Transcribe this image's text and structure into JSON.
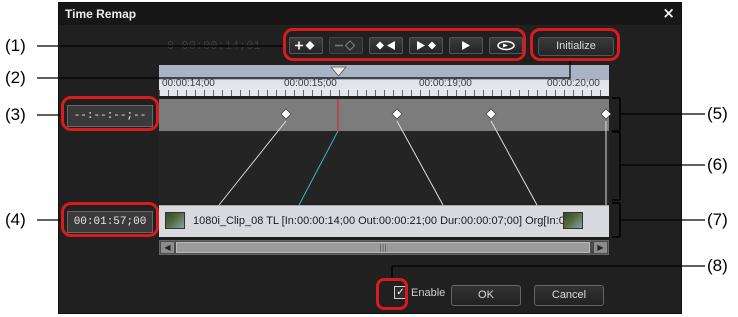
{
  "window": {
    "title": "Time Remap",
    "close_glyph": "×"
  },
  "background_timecode": "0  00:00:14;01",
  "toolbar": {
    "buttons": [
      {
        "name": "add-keyframe-button",
        "icon": "add-keyframe-icon"
      },
      {
        "name": "delete-keyframe-button",
        "icon": "delete-keyframe-icon"
      },
      {
        "name": "prev-keyframe-button",
        "icon": "prev-keyframe-icon"
      },
      {
        "name": "next-keyframe-button",
        "icon": "next-keyframe-icon"
      },
      {
        "name": "play-button",
        "icon": "play-icon"
      },
      {
        "name": "loop-button",
        "icon": "loop-icon"
      }
    ],
    "initialize_label": "Initialize"
  },
  "ruler": {
    "labels": [
      "00:00:14;00",
      "00:00:15;00",
      "00:00:19;00",
      "00:00:20;00"
    ]
  },
  "timecodes": {
    "keyframe_position": "--:--:--;--",
    "clip_position": "00:01:57;00"
  },
  "clip": {
    "text": "1080i_Clip_08  TL [In:00:00:14;00 Out:00:00:21;00 Dur:00:00:07;00] Org[In:0"
  },
  "scrollbar": {
    "left_glyph": "◀",
    "right_glyph": "▶",
    "grip": "|||"
  },
  "footer": {
    "enable_label": "Enable",
    "enable_checked": true,
    "ok_label": "OK",
    "cancel_label": "Cancel"
  },
  "callouts": [
    "(1)",
    "(2)",
    "(3)",
    "(4)",
    "(5)",
    "(6)",
    "(7)",
    "(8)"
  ],
  "colors": {
    "callout_ring": "#d81c1c",
    "playhead": "#c83232",
    "curve_active": "#3fb4b4"
  }
}
